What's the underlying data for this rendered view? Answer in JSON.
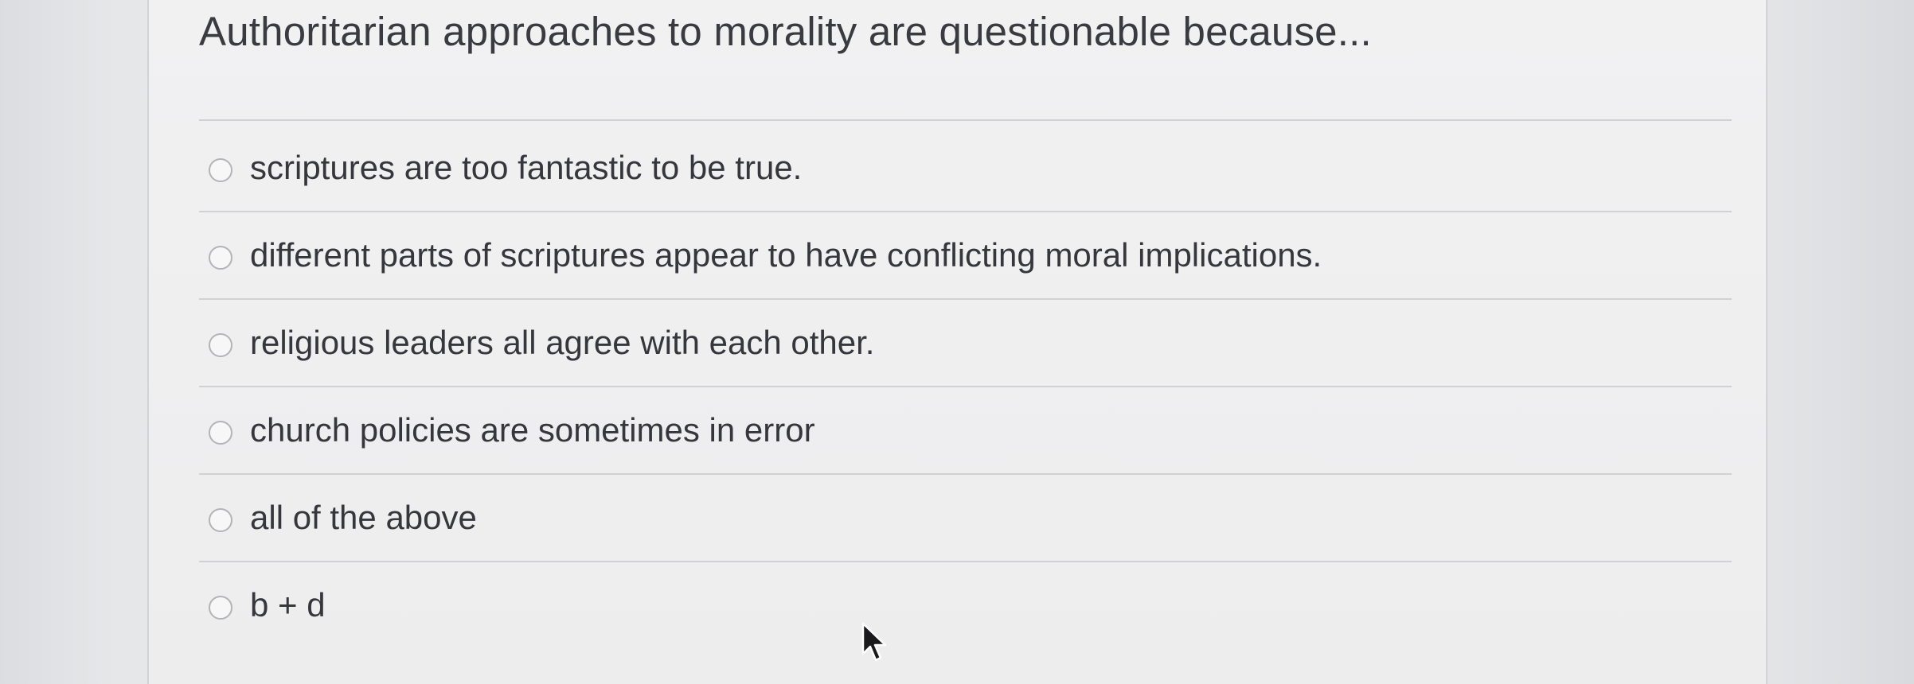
{
  "question": {
    "text": "Authoritarian approaches to morality are questionable because..."
  },
  "options": [
    {
      "label": "scriptures are too fantastic to be true.",
      "selected": false
    },
    {
      "label": "different parts of scriptures appear to have conflicting moral implications.",
      "selected": false
    },
    {
      "label": "religious leaders all agree with each other.",
      "selected": false
    },
    {
      "label": "church policies are sometimes in error",
      "selected": false
    },
    {
      "label": "all of the above",
      "selected": false
    },
    {
      "label": "b + d",
      "selected": false
    }
  ],
  "icons": {
    "radio": "radio-unselected-icon",
    "pointer": "mouse-pointer-icon"
  },
  "colors": {
    "text": "#36373c",
    "divider": "#d0d1d4",
    "radio_border": "#b2b4b8"
  }
}
